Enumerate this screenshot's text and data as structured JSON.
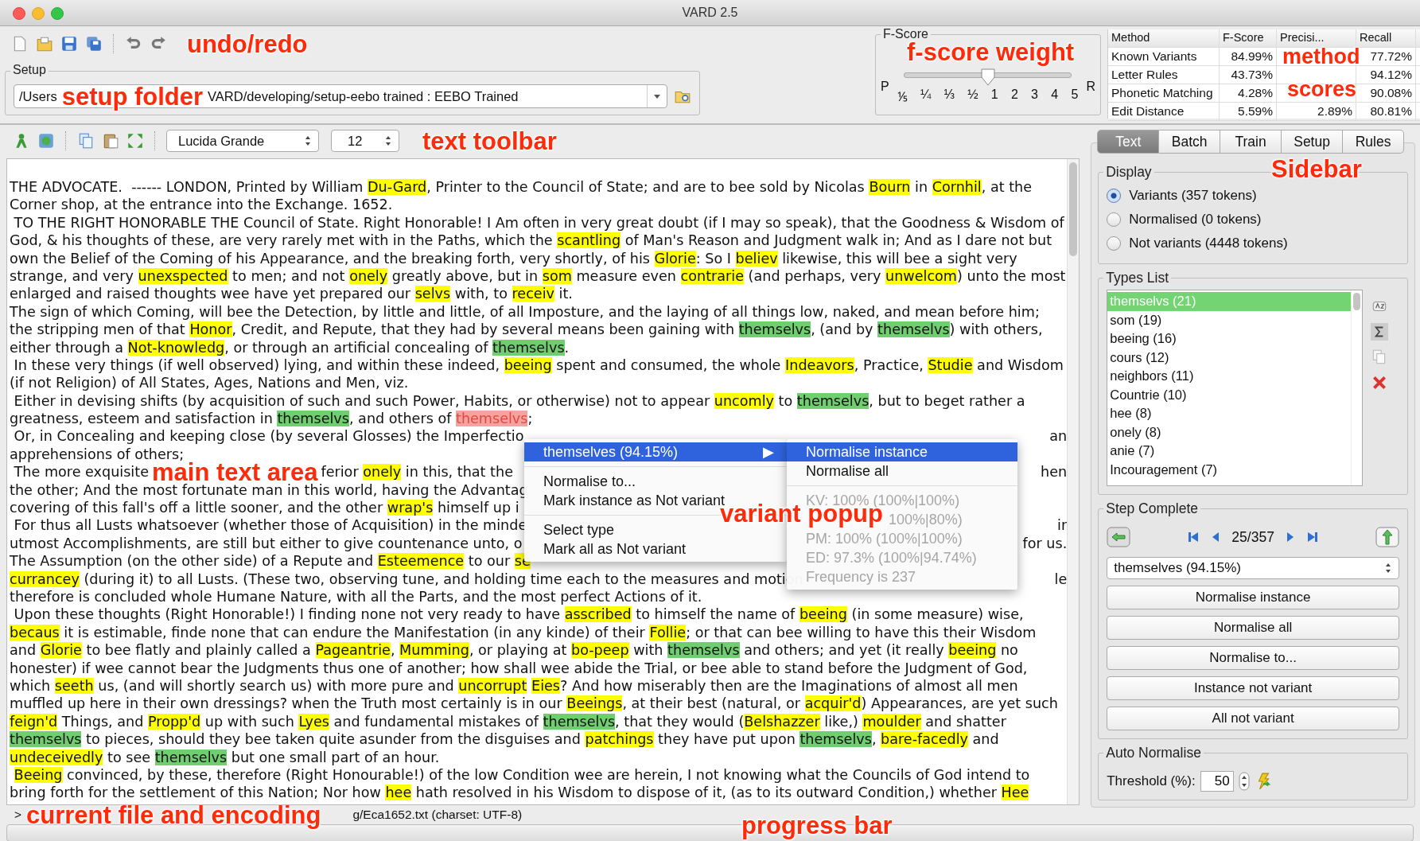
{
  "window": {
    "title": "VARD 2.5"
  },
  "setup": {
    "label": "Setup",
    "path_parts": [
      "/Users",
      "VARD/developing/setup-eebo trained : EEBO Trained"
    ]
  },
  "fscore": {
    "label": "F-Score",
    "left": "P",
    "right": "R",
    "ticks": [
      "⅕",
      "¼",
      "⅓",
      "½",
      "1",
      "2",
      "3",
      "4",
      "5"
    ],
    "level": 0.5
  },
  "methods": {
    "columns": [
      "Method",
      "F-Score",
      "Precisi...",
      "Recall"
    ],
    "rows": [
      [
        "Known Variants",
        "84.99%",
        null,
        "77.72%"
      ],
      [
        "Letter Rules",
        "43.73%",
        null,
        "94.12%"
      ],
      [
        "Phonetic Matching",
        "4.28%",
        null,
        "90.08%"
      ],
      [
        "Edit Distance",
        "5.59%",
        "2.89%",
        "80.81%"
      ]
    ]
  },
  "text_toolbar": {
    "font": "Lucida Grande",
    "size": "12"
  },
  "text_lines": [
    {
      "segments": [
        {
          "text": "THE ADVOCATE.  ------ LONDON, Printed by William ",
          "kind": "plain"
        },
        {
          "text": "Du-Gard",
          "kind": "variant"
        },
        {
          "text": ", Printer to the Council of State; and are to bee sold by Nicolas ",
          "kind": "plain"
        },
        {
          "text": "Bourn",
          "kind": "variant"
        },
        {
          "text": " in ",
          "kind": "plain"
        },
        {
          "text": "Cornhil",
          "kind": "variant"
        },
        {
          "text": ", at the",
          "kind": "plain"
        }
      ]
    },
    {
      "segments": [
        {
          "text": "Corner shop, at the entrance into the Exchange. 1652.",
          "kind": "plain"
        }
      ]
    },
    {
      "segments": [
        {
          "text": " TO THE RIGHT HONORABLE THE Council of State. Right Honorable! I Am often in very great doubt (if I may so speak), that the Goodness & Wisdom of",
          "kind": "plain"
        }
      ]
    },
    {
      "segments": [
        {
          "text": "God, & his thoughts of these, are very rarely met with in the Paths, which the ",
          "kind": "plain"
        },
        {
          "text": "scantling",
          "kind": "variant"
        },
        {
          "text": " of Man's Reason and Judgment walk in; And as I dare not but",
          "kind": "plain"
        }
      ]
    },
    {
      "segments": [
        {
          "text": "own the Belief of the Coming of his Appearance, and the breaking forth, very shortly, of his ",
          "kind": "plain"
        },
        {
          "text": "Glorie",
          "kind": "variant"
        },
        {
          "text": ": So I ",
          "kind": "plain"
        },
        {
          "text": "believ",
          "kind": "variant"
        },
        {
          "text": " likewise, this will bee a sight very",
          "kind": "plain"
        }
      ]
    },
    {
      "segments": [
        {
          "text": "strange, and very ",
          "kind": "plain"
        },
        {
          "text": "unexspected",
          "kind": "variant"
        },
        {
          "text": " to men; and not ",
          "kind": "plain"
        },
        {
          "text": "onely",
          "kind": "variant"
        },
        {
          "text": " greatly above, but in ",
          "kind": "plain"
        },
        {
          "text": "som",
          "kind": "variant"
        },
        {
          "text": " measure even ",
          "kind": "plain"
        },
        {
          "text": "contrarie",
          "kind": "variant"
        },
        {
          "text": " (and perhaps, very ",
          "kind": "plain"
        },
        {
          "text": "unwelcom",
          "kind": "variant"
        },
        {
          "text": ") unto the most",
          "kind": "plain"
        }
      ]
    },
    {
      "segments": [
        {
          "text": "enlarged and raised thoughts wee have yet prepared our ",
          "kind": "plain"
        },
        {
          "text": "selvs",
          "kind": "variant"
        },
        {
          "text": " with, to ",
          "kind": "plain"
        },
        {
          "text": "receiv",
          "kind": "variant"
        },
        {
          "text": " it.",
          "kind": "plain"
        }
      ]
    },
    {
      "segments": [
        {
          "text": "The sign of which Coming, will bee the Detection, by little and little, of all Imposture, and the laying of all things low, naked, and mean before him;",
          "kind": "plain"
        }
      ]
    },
    {
      "segments": [
        {
          "text": "the stripping men of that ",
          "kind": "plain"
        },
        {
          "text": "Honor",
          "kind": "variant"
        },
        {
          "text": ", Credit, and Repute, that they had by several means been gaining with ",
          "kind": "plain"
        },
        {
          "text": "themselvs",
          "kind": "type"
        },
        {
          "text": ", (and by ",
          "kind": "plain"
        },
        {
          "text": "themselvs",
          "kind": "type"
        },
        {
          "text": ") with others,",
          "kind": "plain"
        }
      ]
    },
    {
      "segments": [
        {
          "text": "either through a ",
          "kind": "plain"
        },
        {
          "text": "Not-knowledg",
          "kind": "variant"
        },
        {
          "text": ", or through an artificial concealing of ",
          "kind": "plain"
        },
        {
          "text": "themselvs",
          "kind": "type"
        },
        {
          "text": ".",
          "kind": "plain"
        }
      ]
    },
    {
      "segments": [
        {
          "text": " In these very things (if well observed) lying, and within these indeed, ",
          "kind": "plain"
        },
        {
          "text": "beeing",
          "kind": "variant"
        },
        {
          "text": " spent and consumed, the whole ",
          "kind": "plain"
        },
        {
          "text": "Indeavors",
          "kind": "variant"
        },
        {
          "text": ", Practice, ",
          "kind": "plain"
        },
        {
          "text": "Studie",
          "kind": "variant"
        },
        {
          "text": " and Wisdom",
          "kind": "plain"
        }
      ]
    },
    {
      "segments": [
        {
          "text": "(if not Religion) of All States, Ages, Nations and Men, viz.",
          "kind": "plain"
        }
      ]
    },
    {
      "segments": [
        {
          "text": " Either in devising shifts (by acquisition of such and such Power, Habits, or otherwise) not to appear ",
          "kind": "plain"
        },
        {
          "text": "uncomly",
          "kind": "variant"
        },
        {
          "text": " to ",
          "kind": "plain"
        },
        {
          "text": "themselvs",
          "kind": "type"
        },
        {
          "text": ", but to beget rather a",
          "kind": "plain"
        }
      ]
    },
    {
      "segments": [
        {
          "text": "greatness, esteem and satisfaction in ",
          "kind": "plain"
        },
        {
          "text": "themselvs",
          "kind": "type"
        },
        {
          "text": ", and others of ",
          "kind": "plain"
        },
        {
          "text": "themselvs",
          "kind": "current"
        },
        {
          "text": ";",
          "kind": "plain"
        }
      ]
    },
    {
      "segments": [
        {
          "text": " Or, in Concealing and keeping close (by several Glosses) the Imperfectio",
          "kind": "plain"
        }
      ],
      "right": "an"
    },
    {
      "segments": [
        {
          "text": "apprehensions of others;",
          "kind": "plain"
        }
      ]
    },
    {
      "segments": [
        {
          "text": " The more exquisite",
          "kind": "plain"
        },
        {
          "kind": "gap"
        },
        {
          "text": "ferior ",
          "kind": "plain"
        },
        {
          "text": "onely",
          "kind": "variant"
        },
        {
          "text": " in this, that the",
          "kind": "plain"
        }
      ],
      "right": "hen"
    },
    {
      "segments": [
        {
          "text": "the other; And the most fortunate man in this world, having the Advantag",
          "kind": "plain"
        }
      ]
    },
    {
      "segments": [
        {
          "text": "covering of this fall's off a little sooner, and the other ",
          "kind": "plain"
        },
        {
          "text": "wrap's",
          "kind": "variant"
        },
        {
          "text": " himself up i",
          "kind": "plain"
        }
      ]
    },
    {
      "segments": [
        {
          "text": " For thus all Lusts whatsoever (whether those of Acquisition) in the minde",
          "kind": "plain"
        }
      ],
      "right": "ir"
    },
    {
      "segments": [
        {
          "text": "utmost Accomplishments, are still but either to give countenance unto, o",
          "kind": "plain"
        }
      ],
      "right": "for us."
    },
    {
      "segments": [
        {
          "text": "The Assumption (on the other side) of a Repute and ",
          "kind": "plain"
        },
        {
          "text": "Esteemence",
          "kind": "variant"
        },
        {
          "text": " to our ",
          "kind": "plain"
        },
        {
          "text": "se",
          "kind": "variant"
        }
      ]
    },
    {
      "segments": [
        {
          "text": "currancey",
          "kind": "variant"
        },
        {
          "text": " (during it) to all Lusts. (These two, observing tune, and holding time each to the measures and motion",
          "kind": "plain"
        }
      ],
      "right": "le"
    },
    {
      "segments": [
        {
          "text": "therefore is concluded whole Humane Nature, with all the Parts, and the most perfect Actions of it.",
          "kind": "plain"
        }
      ]
    },
    {
      "segments": [
        {
          "text": " Upon these thoughts (Right Honorable!) I finding none not very ready to have ",
          "kind": "plain"
        },
        {
          "text": "asscribed",
          "kind": "variant"
        },
        {
          "text": " to himself the name of ",
          "kind": "plain"
        },
        {
          "text": "beeing",
          "kind": "variant"
        },
        {
          "text": " (in some measure) wise,",
          "kind": "plain"
        }
      ]
    },
    {
      "segments": [
        {
          "text": "becaus",
          "kind": "variant"
        },
        {
          "text": " it is estimable, finde none that can endure the Manifestation (in any kinde) of their ",
          "kind": "plain"
        },
        {
          "text": "Follie",
          "kind": "variant"
        },
        {
          "text": "; or that can bee willing to have this their Wisdom",
          "kind": "plain"
        }
      ]
    },
    {
      "segments": [
        {
          "text": "and ",
          "kind": "plain"
        },
        {
          "text": "Glorie",
          "kind": "variant"
        },
        {
          "text": " to bee flatly and plainly called a ",
          "kind": "plain"
        },
        {
          "text": "Pageantrie",
          "kind": "variant"
        },
        {
          "text": ", ",
          "kind": "plain"
        },
        {
          "text": "Mumming",
          "kind": "variant"
        },
        {
          "text": ", or playing at ",
          "kind": "plain"
        },
        {
          "text": "bo-peep",
          "kind": "variant"
        },
        {
          "text": " with ",
          "kind": "plain"
        },
        {
          "text": "themselvs",
          "kind": "type"
        },
        {
          "text": " and others; and yet (it really ",
          "kind": "plain"
        },
        {
          "text": "beeing",
          "kind": "variant"
        },
        {
          "text": " no",
          "kind": "plain"
        }
      ]
    },
    {
      "segments": [
        {
          "text": "honester) if wee cannot bear the Judgments thus one of another; how shall wee abide the Trial, or bee able to stand before the Judgment of God,",
          "kind": "plain"
        }
      ]
    },
    {
      "segments": [
        {
          "text": "which ",
          "kind": "plain"
        },
        {
          "text": "seeth",
          "kind": "variant"
        },
        {
          "text": " us, (and will shortly search us) with more pure and ",
          "kind": "plain"
        },
        {
          "text": "uncorrupt",
          "kind": "variant"
        },
        {
          "kind": "space"
        },
        {
          "text": "Eies",
          "kind": "variant"
        },
        {
          "text": "? And how miserably then are the Imaginations of almost all men",
          "kind": "plain"
        }
      ]
    },
    {
      "segments": [
        {
          "text": "muffled up here in their own dressings? when the Truth most certainly is in our ",
          "kind": "plain"
        },
        {
          "text": "Beeings",
          "kind": "variant"
        },
        {
          "text": ", at their best (natural, or ",
          "kind": "plain"
        },
        {
          "text": "acquir'd",
          "kind": "variant"
        },
        {
          "text": ") Appearances, are yet such",
          "kind": "plain"
        }
      ]
    },
    {
      "segments": [
        {
          "text": "feign'd",
          "kind": "variant"
        },
        {
          "text": " Things, and ",
          "kind": "plain"
        },
        {
          "text": "Propp'd",
          "kind": "variant"
        },
        {
          "text": " up with such ",
          "kind": "plain"
        },
        {
          "text": "Lyes",
          "kind": "variant"
        },
        {
          "text": " and fundamental mistakes of ",
          "kind": "plain"
        },
        {
          "text": "themselvs",
          "kind": "type"
        },
        {
          "text": ", that they would (",
          "kind": "plain"
        },
        {
          "text": "Belshazzer",
          "kind": "variant"
        },
        {
          "text": " like,) ",
          "kind": "plain"
        },
        {
          "text": "moulder",
          "kind": "variant"
        },
        {
          "text": " and shatter",
          "kind": "plain"
        }
      ]
    },
    {
      "segments": [
        {
          "text": "themselvs",
          "kind": "type"
        },
        {
          "text": " to pieces, should they bee taken quite asunder from the disguises and ",
          "kind": "plain"
        },
        {
          "text": "patchings",
          "kind": "variant"
        },
        {
          "text": " they have put upon ",
          "kind": "plain"
        },
        {
          "text": "themselvs",
          "kind": "type"
        },
        {
          "text": ", ",
          "kind": "plain"
        },
        {
          "text": "bare-facedly",
          "kind": "variant"
        },
        {
          "text": " and",
          "kind": "plain"
        }
      ]
    },
    {
      "segments": [
        {
          "text": "undeceivedly",
          "kind": "variant"
        },
        {
          "text": " to see ",
          "kind": "plain"
        },
        {
          "text": "themselvs",
          "kind": "type"
        },
        {
          "text": " but one small part of an hour.",
          "kind": "plain"
        }
      ]
    },
    {
      "segments": [
        {
          "kind": "space"
        },
        {
          "text": "Beeing",
          "kind": "variant"
        },
        {
          "text": " convinced, by these, therefore (Right Honourable!) of the low Condition wee are herein, I not knowing what the Councils of God intend to",
          "kind": "plain"
        }
      ]
    },
    {
      "segments": [
        {
          "text": "bring forth for the settlement of this Nation; Nor how ",
          "kind": "plain"
        },
        {
          "text": "hee",
          "kind": "variant"
        },
        {
          "text": " hath resolved in his Wisdom to dispose of it, (as to its outward Condition,) whether ",
          "kind": "plain"
        },
        {
          "text": "Hee",
          "kind": "variant"
        }
      ]
    }
  ],
  "popup": {
    "items": [
      {
        "kind": "submenu",
        "label": "themselves (94.15%)",
        "arrow": "▶",
        "selected": true
      },
      {
        "kind": "separator"
      },
      {
        "kind": "item",
        "label": "Normalise to...",
        "selected": false
      },
      {
        "kind": "item",
        "label": "Mark instance as Not variant",
        "selected": false
      },
      {
        "kind": "separator"
      },
      {
        "kind": "item",
        "label": "Select type",
        "selected": false
      },
      {
        "kind": "item",
        "label": "Mark all as Not variant",
        "selected": false
      }
    ],
    "submenu": [
      {
        "kind": "item",
        "label": "Normalise instance",
        "selected": true,
        "disabled": false
      },
      {
        "kind": "item",
        "label": "Normalise all",
        "selected": false,
        "disabled": false
      },
      {
        "kind": "separator"
      },
      {
        "kind": "item",
        "label": "KV: 100% (100%|100%)",
        "selected": false,
        "disabled": true
      },
      {
        "kind": "item",
        "label": "100%|80%)",
        "selected": false,
        "disabled": true,
        "covered_start": true
      },
      {
        "kind": "item",
        "label": "PM: 100% (100%|100%)",
        "selected": false,
        "disabled": true
      },
      {
        "kind": "item",
        "label": "ED: 97.3% (100%|94.74%)",
        "selected": false,
        "disabled": true
      },
      {
        "kind": "item",
        "label": "Frequency is 237",
        "selected": false,
        "disabled": true
      }
    ]
  },
  "status": {
    "parts": [
      ">",
      "g/Eca1652.txt (charset: UTF-8)"
    ]
  },
  "progress": {
    "level": 0
  },
  "sidebar": {
    "tabs": [
      {
        "label": "Text",
        "selected": true
      },
      {
        "label": "Batch",
        "selected": false
      },
      {
        "label": "Train",
        "selected": false
      },
      {
        "label": "Setup",
        "selected": false
      },
      {
        "label": "Rules",
        "selected": false
      }
    ],
    "display": {
      "label": "Display",
      "options": [
        {
          "label": "Variants (357 tokens)",
          "selected": true
        },
        {
          "label": "Normalised (0 tokens)",
          "selected": false
        },
        {
          "label": "Not variants (4448 tokens)",
          "selected": false
        }
      ]
    },
    "types": {
      "label": "Types List",
      "items": [
        {
          "label": "themselvs (21)",
          "selected": true
        },
        {
          "label": "som (19)",
          "selected": false
        },
        {
          "label": "beeing (16)",
          "selected": false
        },
        {
          "label": "cours (12)",
          "selected": false
        },
        {
          "label": "neighbors (11)",
          "selected": false
        },
        {
          "label": "Countrie (10)",
          "selected": false
        },
        {
          "label": "hee (8)",
          "selected": false
        },
        {
          "label": "onely (8)",
          "selected": false
        },
        {
          "label": "anie (7)",
          "selected": false
        },
        {
          "label": "Incouragement (7)",
          "selected": false
        }
      ]
    },
    "step": {
      "label": "Step Complete",
      "position": "25/357",
      "choice": "themselves (94.15%)",
      "buttons": [
        "Normalise instance",
        "Normalise all",
        "Normalise to...",
        "Instance not variant",
        "All not variant"
      ]
    },
    "auto": {
      "label": "Auto Normalise",
      "threshold_label": "Threshold (%):",
      "threshold": "50"
    }
  },
  "annotations": [
    "undo/redo",
    "setup folder",
    "f-score weight",
    "method",
    "scores",
    "text toolbar",
    "Sidebar",
    "main text area",
    "variant popup",
    "current file and encoding",
    "progress bar"
  ]
}
